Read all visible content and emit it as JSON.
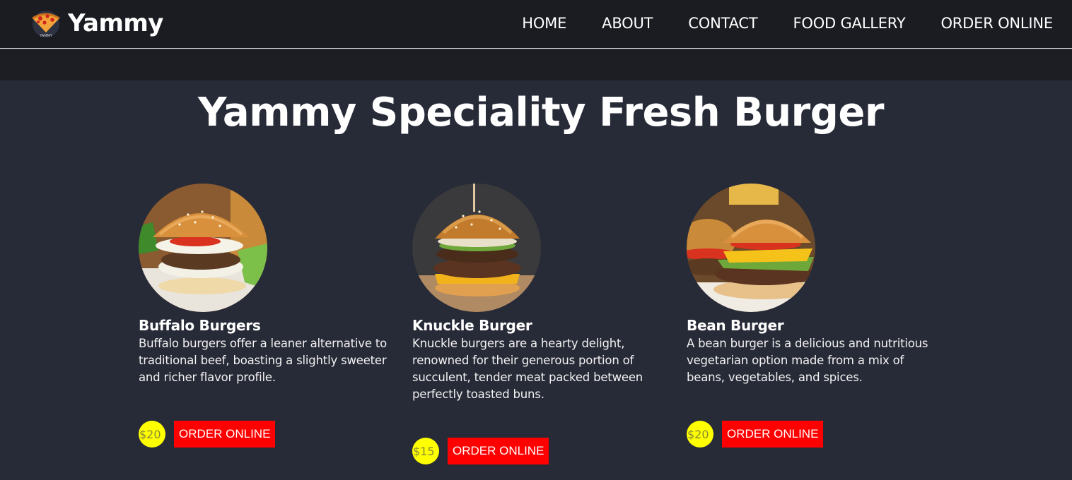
{
  "brand": {
    "name": "Yammy",
    "logo_caption": "YAMMY"
  },
  "nav": {
    "items": [
      {
        "label": "HOME"
      },
      {
        "label": "ABOUT"
      },
      {
        "label": "CONTACT"
      },
      {
        "label": "FOOD GALLERY"
      },
      {
        "label": "ORDER ONLINE"
      }
    ]
  },
  "section": {
    "title": "Yammy Speciality Fresh Burger"
  },
  "products": [
    {
      "name": "Buffalo Burgers",
      "description": "Buffalo burgers offer a leaner alternative to traditional beef, boasting a slightly sweeter and richer flavor profile.",
      "price": "$20",
      "cta": "ORDER ONLINE"
    },
    {
      "name": "Knuckle Burger",
      "description": "Knuckle burgers are a hearty delight, renowned for their generous portion of succulent, tender meat packed between perfectly toasted buns.",
      "price": "$15",
      "cta": "ORDER ONLINE"
    },
    {
      "name": "Bean Burger",
      "description": "A bean burger is a delicious and nutritious vegetarian option made from a mix of beans, vegetables, and spices.",
      "price": "$20",
      "cta": "ORDER ONLINE"
    }
  ],
  "colors": {
    "page_background": "#272a37",
    "navbar_background": "#1a1c22",
    "price_badge": "#ffff00",
    "order_button": "#ff0000"
  }
}
